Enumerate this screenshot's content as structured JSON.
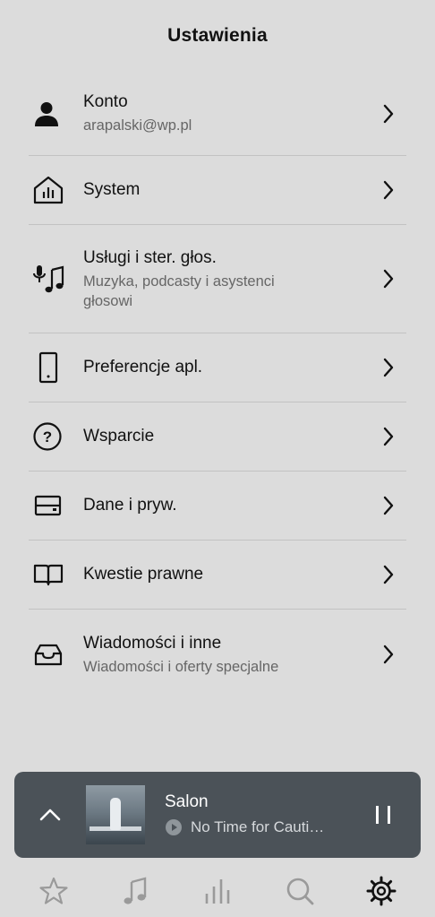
{
  "header": {
    "title": "Ustawienia"
  },
  "settings": {
    "items": [
      {
        "title": "Konto",
        "subtitle": "arapalski@wp.pl",
        "icon": "person-icon"
      },
      {
        "title": "System",
        "subtitle": "",
        "icon": "home-eq-icon"
      },
      {
        "title": "Usługi i ster. głos.",
        "subtitle": "Muzyka, podcasty i asystenci głosowi",
        "icon": "mic-music-icon"
      },
      {
        "title": "Preferencje apl.",
        "subtitle": "",
        "icon": "phone-icon"
      },
      {
        "title": "Wsparcie",
        "subtitle": "",
        "icon": "help-circle-icon"
      },
      {
        "title": "Dane i pryw.",
        "subtitle": "",
        "icon": "storage-icon"
      },
      {
        "title": "Kwestie prawne",
        "subtitle": "",
        "icon": "book-icon"
      },
      {
        "title": "Wiadomości i inne",
        "subtitle": "Wiadomości i oferty specjalne",
        "icon": "inbox-icon"
      }
    ]
  },
  "player": {
    "room": "Salon",
    "track": "No Time for Cauti…",
    "state": "playing"
  },
  "tabs": [
    {
      "name": "tab-favorites",
      "icon": "star-icon"
    },
    {
      "name": "tab-music",
      "icon": "music-note-icon"
    },
    {
      "name": "tab-rooms",
      "icon": "equalizer-bars-icon"
    },
    {
      "name": "tab-search",
      "icon": "search-icon"
    },
    {
      "name": "tab-settings",
      "icon": "gear-icon",
      "active": true
    }
  ],
  "colors": {
    "background": "#dcdcdc",
    "divider": "#c2c2c2",
    "player_bg": "#4b5258",
    "inactive_tab": "#9a9a9a",
    "active_tab": "#111111"
  }
}
